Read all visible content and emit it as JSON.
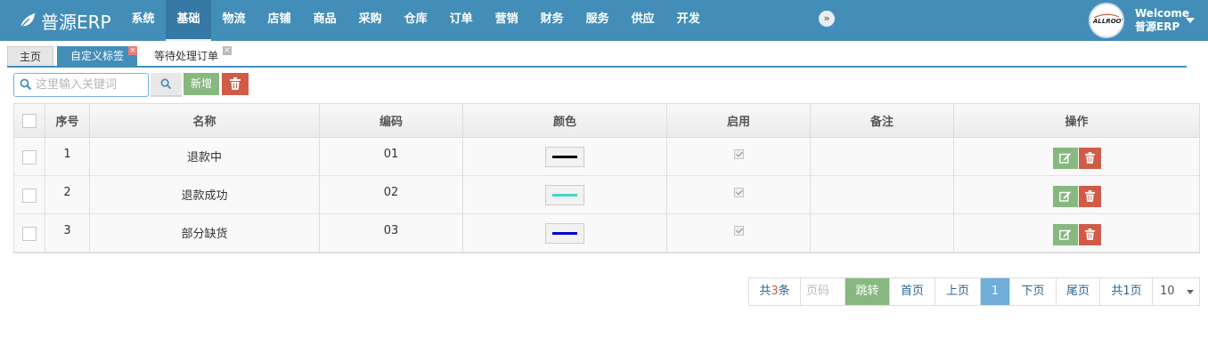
{
  "brand": {
    "name": "普源ERP"
  },
  "nav": {
    "items": [
      "系统",
      "基础",
      "物流",
      "店铺",
      "商品",
      "采购",
      "仓库",
      "订单",
      "营销",
      "财务",
      "服务",
      "供应",
      "开发"
    ],
    "active_index": 1,
    "collapse_label": "»"
  },
  "user": {
    "welcome": "Welcome",
    "name": "普源ERP",
    "avatar_text": "ALLROOT"
  },
  "tabs": [
    {
      "label": "主页"
    },
    {
      "label": "自定义标签"
    },
    {
      "label": "等待处理订单"
    }
  ],
  "toolbar": {
    "search_placeholder": "这里输入关键词",
    "add_label": "新增"
  },
  "table": {
    "headers": [
      "序号",
      "名称",
      "编码",
      "颜色",
      "启用",
      "备注",
      "操作"
    ],
    "rows": [
      {
        "index": "1",
        "name": "退款中",
        "code": "01",
        "color": "#000000",
        "enabled": true,
        "note": ""
      },
      {
        "index": "2",
        "name": "退款成功",
        "code": "02",
        "color": "#48d1cc",
        "enabled": true,
        "note": ""
      },
      {
        "index": "3",
        "name": "部分缺货",
        "code": "03",
        "color": "#0000cd",
        "enabled": true,
        "note": ""
      }
    ]
  },
  "pager": {
    "total_prefix": "共",
    "total_count": "3",
    "total_suffix": "条",
    "page_placeholder": "页码",
    "jump_label": "跳转",
    "first_label": "首页",
    "prev_label": "上页",
    "current_page": "1",
    "next_label": "下页",
    "last_label": "尾页",
    "pages_label": "共1页",
    "page_size": "10"
  },
  "colors": {
    "primary": "#438eb9",
    "success": "#87b87f",
    "danger": "#d15b47"
  }
}
